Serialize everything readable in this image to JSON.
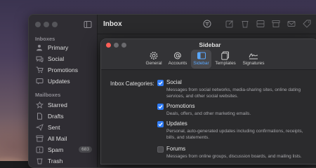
{
  "mail": {
    "inbox_title": "Inbox",
    "sidebar": {
      "section_inboxes": "Inboxes",
      "inboxes": [
        {
          "label": "Primary",
          "icon": "person-icon"
        },
        {
          "label": "Social",
          "icon": "chat-bubble-icon"
        },
        {
          "label": "Promotions",
          "icon": "cart-icon"
        },
        {
          "label": "Updates",
          "icon": "message-icon"
        }
      ],
      "section_mailboxes": "Mailboxes",
      "mailboxes": [
        {
          "label": "Starred",
          "icon": "star-icon",
          "badge": ""
        },
        {
          "label": "Drafts",
          "icon": "doc-icon",
          "badge": ""
        },
        {
          "label": "Sent",
          "icon": "send-icon",
          "badge": ""
        },
        {
          "label": "All Mail",
          "icon": "archive-icon",
          "badge": ""
        },
        {
          "label": "Spam",
          "icon": "spam-icon",
          "badge": "683"
        },
        {
          "label": "Trash",
          "icon": "trash-icon",
          "badge": ""
        }
      ]
    }
  },
  "dialog": {
    "title": "Sidebar",
    "tabs": [
      {
        "label": "General",
        "icon": "gear-icon"
      },
      {
        "label": "Accounts",
        "icon": "at-icon"
      },
      {
        "label": "Sidebar",
        "icon": "sidebar-icon"
      },
      {
        "label": "Templates",
        "icon": "templates-icon"
      },
      {
        "label": "Signatures",
        "icon": "signature-icon"
      }
    ],
    "active_tab": "Sidebar",
    "inbox_categories_label": "Inbox Categories:",
    "options": [
      {
        "title": "Social",
        "checked": true,
        "description": "Messages from social networks, media-sharing sites, online dating services, and other social websites."
      },
      {
        "title": "Promotions",
        "checked": true,
        "description": "Deals, offers, and other marketing emails."
      },
      {
        "title": "Updates",
        "checked": true,
        "description": "Personal, auto-generated updates including confirmations, receipts, bills, and statements."
      },
      {
        "title": "Forums",
        "checked": false,
        "description": "Messages from online groups, discussion boards, and mailing lists."
      }
    ]
  },
  "colors": {
    "accent": "#2f7cf6",
    "active_tab_label": "#5aa8ff",
    "traffic_close": "#ff5f57",
    "traffic_min": "#febc2e",
    "traffic_max": "#28c840"
  }
}
